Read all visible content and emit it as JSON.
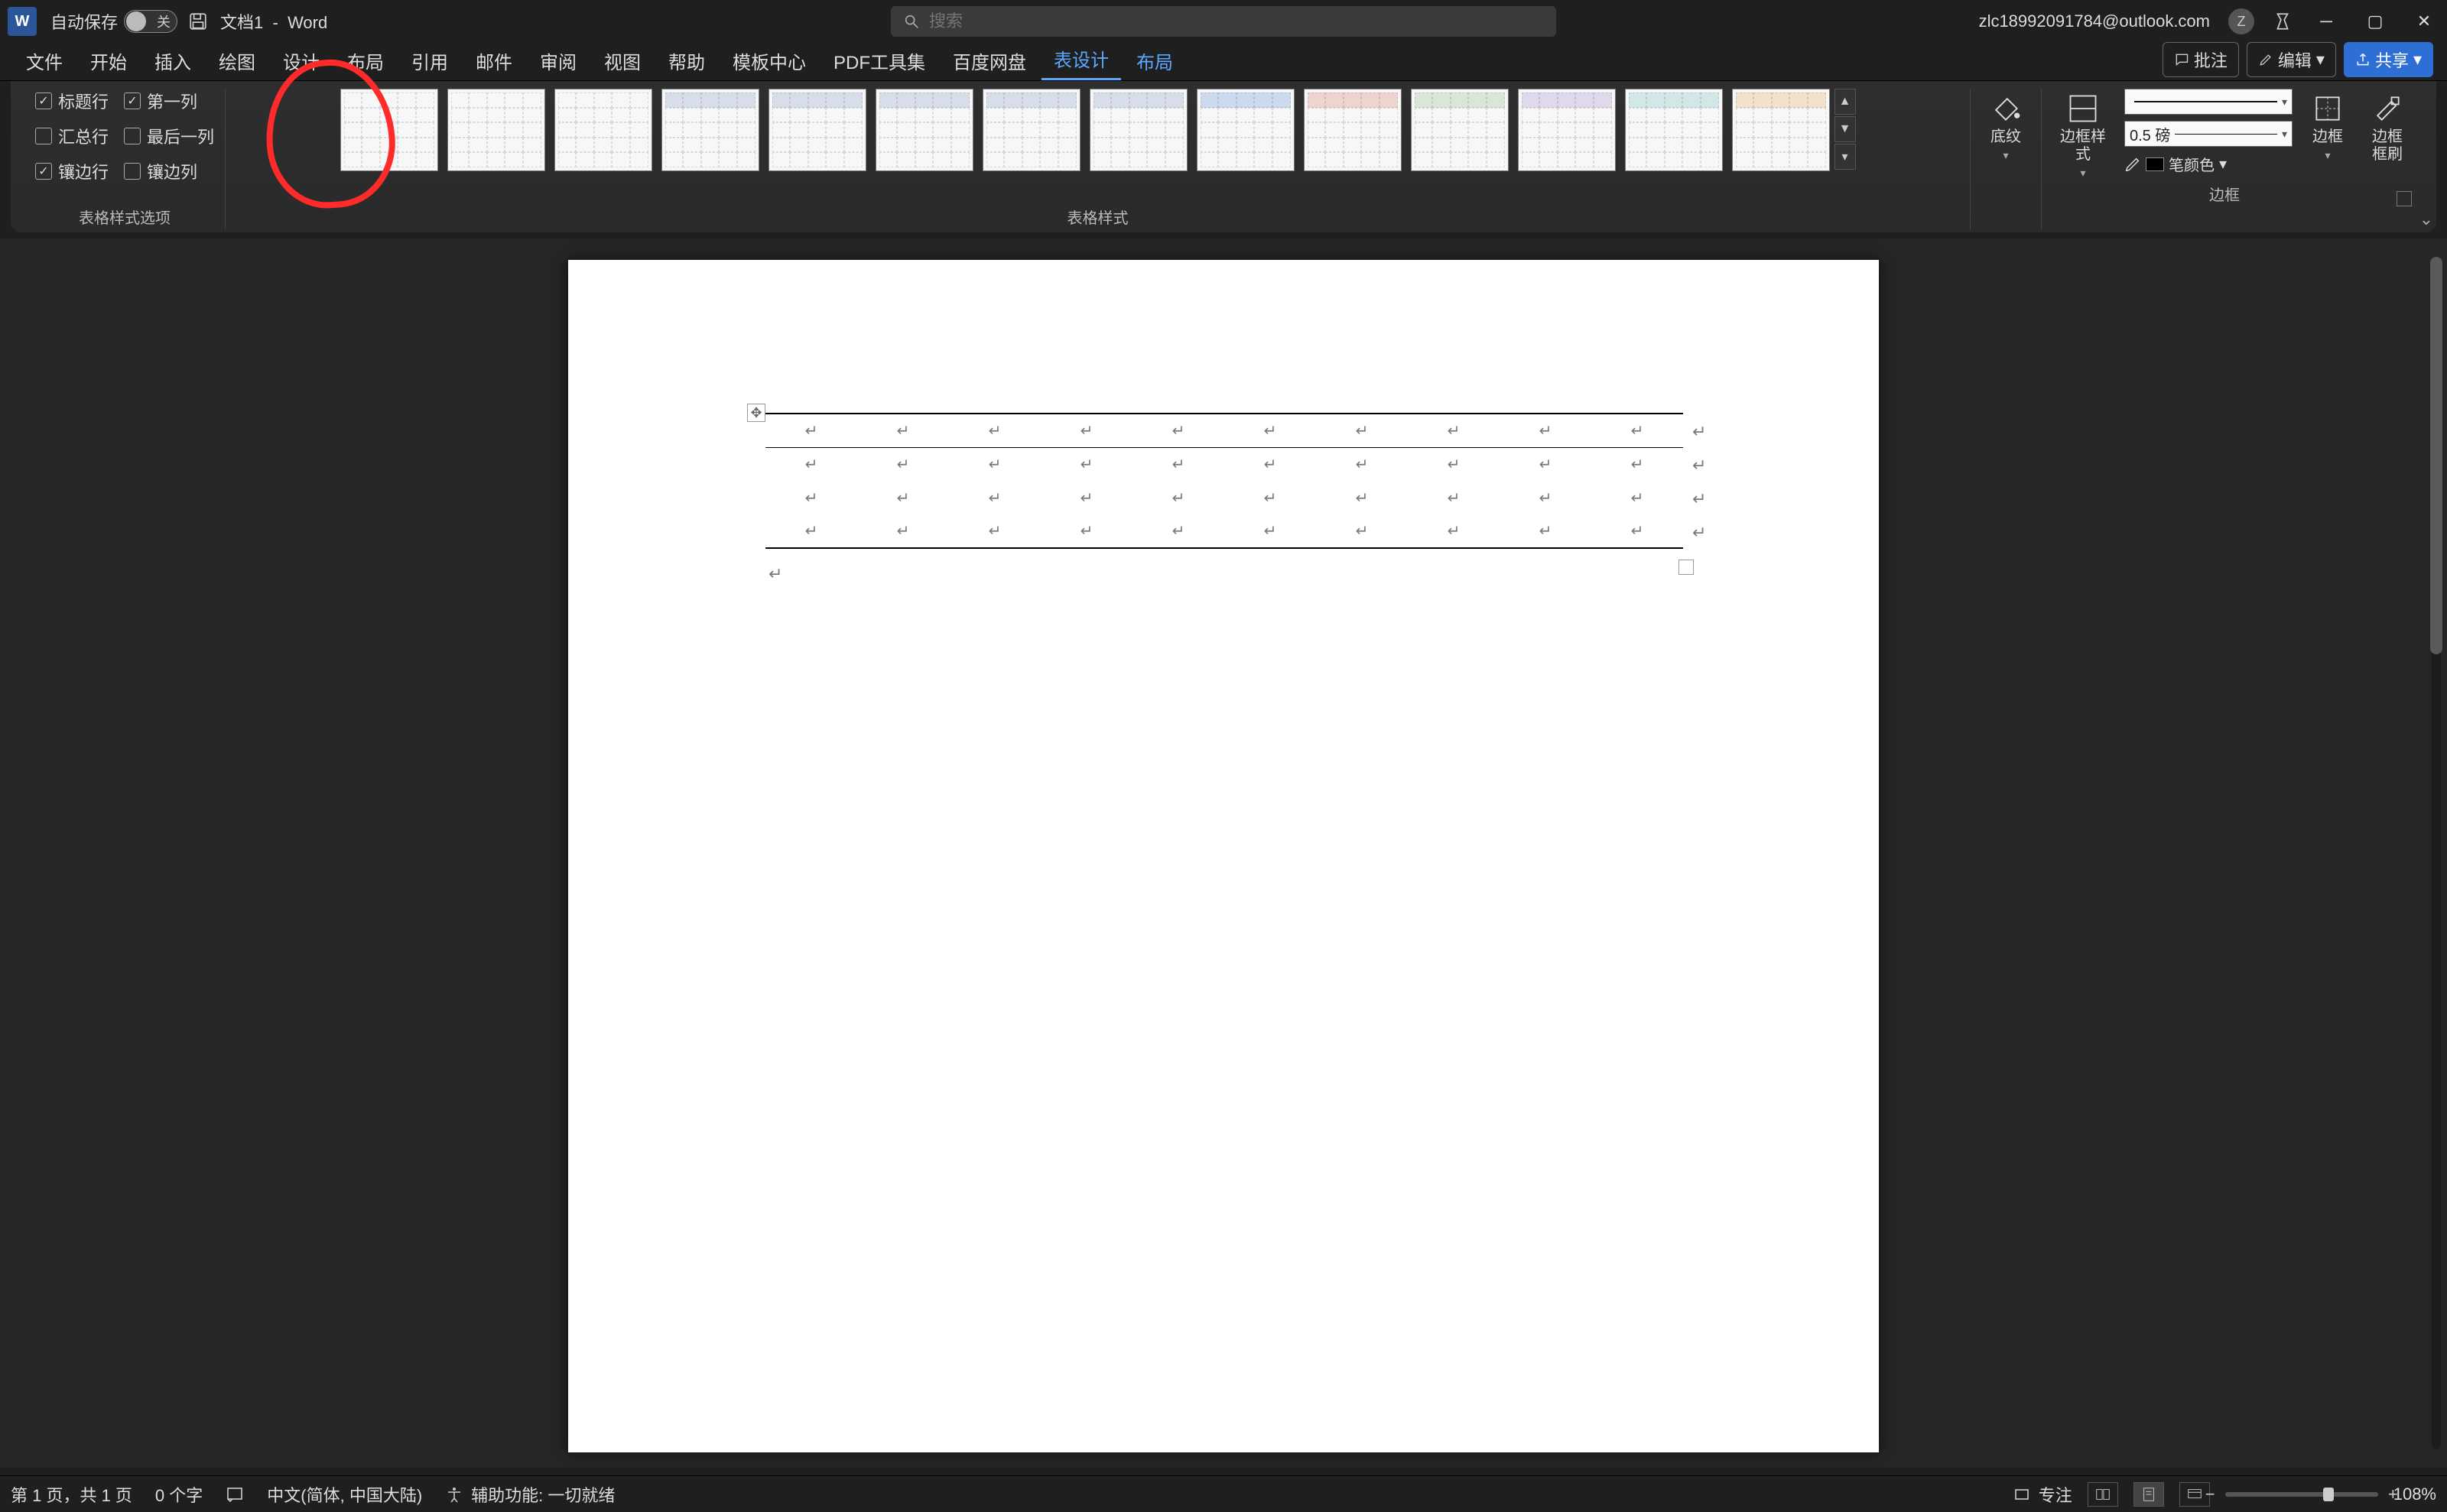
{
  "title": {
    "autosave_label": "自动保存",
    "autosave_state": "关",
    "doc_name": "文档1",
    "app_suffix": "Word",
    "separator": "-",
    "search_placeholder": "搜索",
    "user_email": "zlc18992091784@outlook.com",
    "avatar_initial": "Z"
  },
  "menu": {
    "items": [
      "文件",
      "开始",
      "插入",
      "绘图",
      "设计",
      "布局",
      "引用",
      "邮件",
      "审阅",
      "视图",
      "帮助",
      "模板中心",
      "PDF工具集",
      "百度网盘",
      "表设计",
      "布局"
    ],
    "active_index": 14,
    "contextual_indices": [
      14,
      15
    ],
    "comments_label": "批注",
    "edit_label": "编辑",
    "share_label": "共享"
  },
  "ribbon": {
    "group_style_options": {
      "label": "表格样式选项",
      "options": [
        {
          "label": "标题行",
          "checked": true
        },
        {
          "label": "第一列",
          "checked": true
        },
        {
          "label": "汇总行",
          "checked": false
        },
        {
          "label": "最后一列",
          "checked": false
        },
        {
          "label": "镶边行",
          "checked": true
        },
        {
          "label": "镶边列",
          "checked": false
        }
      ]
    },
    "group_table_styles": {
      "label": "表格样式"
    },
    "shading_label": "底纹",
    "border_style_label": "边框样\n式",
    "pen_weight_value": "0.5 磅",
    "pen_color_label": "笔颜色",
    "borders_label": "边框",
    "border_painter_label": "边框\n框刷",
    "group_borders_label": "边框"
  },
  "status": {
    "page_info": "第 1 页，共 1 页",
    "word_count": "0 个字",
    "language": "中文(简体, 中国大陆)",
    "accessibility": "辅助功能: 一切就绪",
    "focus_label": "专注",
    "zoom_value": "108%"
  }
}
